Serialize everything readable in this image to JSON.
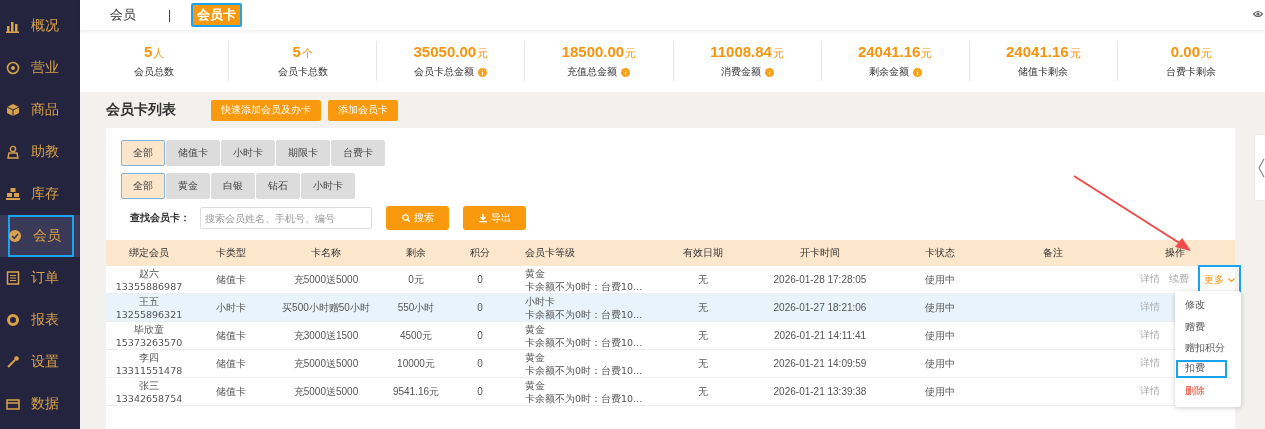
{
  "sidebar": {
    "items": [
      {
        "label": "概况",
        "selected": false,
        "highlighted": false
      },
      {
        "label": "营业",
        "selected": false,
        "highlighted": false
      },
      {
        "label": "商品",
        "selected": false,
        "highlighted": false
      },
      {
        "label": "助教",
        "selected": false,
        "highlighted": false
      },
      {
        "label": "库存",
        "selected": false,
        "highlighted": false
      },
      {
        "label": "会员",
        "selected": true,
        "highlighted": true
      },
      {
        "label": "订单",
        "selected": false,
        "highlighted": false
      },
      {
        "label": "报表",
        "selected": false,
        "highlighted": false
      },
      {
        "label": "设置",
        "selected": false,
        "highlighted": false
      },
      {
        "label": "数据",
        "selected": false,
        "highlighted": false
      }
    ]
  },
  "tabs": [
    {
      "label": "会员",
      "selected": false,
      "highlighted": false
    },
    {
      "label": "会员卡",
      "selected": true,
      "highlighted": true
    }
  ],
  "tab_separator": "|",
  "stats": [
    {
      "value": "5",
      "unit": "人",
      "label": "会员总数",
      "info": false
    },
    {
      "value": "5",
      "unit": "个",
      "label": "会员卡总数",
      "info": false
    },
    {
      "value": "35050.00",
      "unit": "元",
      "label": "会员卡总金额",
      "info": true
    },
    {
      "value": "18500.00",
      "unit": "元",
      "label": "充值总金额",
      "info": true
    },
    {
      "value": "11008.84",
      "unit": "元",
      "label": "消费金额",
      "info": true
    },
    {
      "value": "24041.16",
      "unit": "元",
      "label": "剩余金额",
      "info": true
    },
    {
      "value": "24041.16",
      "unit": "元",
      "label": "储值卡剩余",
      "info": false
    },
    {
      "value": "0.00",
      "unit": "元",
      "label": "台费卡剩余",
      "info": false
    }
  ],
  "list_title": "会员卡列表",
  "header_buttons": [
    "快速添加会员及办卡",
    "添加会员卡"
  ],
  "card_type_filter": [
    {
      "label": "全部",
      "selected": true
    },
    {
      "label": "储值卡",
      "selected": false
    },
    {
      "label": "小时卡",
      "selected": false
    },
    {
      "label": "期限卡",
      "selected": false
    },
    {
      "label": "台费卡",
      "selected": false
    }
  ],
  "level_filter": [
    {
      "label": "全部",
      "selected": true
    },
    {
      "label": "黄金",
      "selected": false
    },
    {
      "label": "白银",
      "selected": false
    },
    {
      "label": "钻石",
      "selected": false
    },
    {
      "label": "小时卡",
      "selected": false
    }
  ],
  "search": {
    "label": "查找会员卡：",
    "placeholder": "搜索会员姓名、手机号、编号",
    "search_button": "搜索",
    "export_button": "导出"
  },
  "table": {
    "columns": [
      "绑定会员",
      "卡类型",
      "卡名称",
      "剩余",
      "积分",
      "会员卡等级",
      "有效日期",
      "开卡时间",
      "卡状态",
      "备注",
      "操作"
    ],
    "rows": [
      {
        "member": "赵六",
        "phone": "13355886987",
        "card_type": "储值卡",
        "card_name": "充5000送5000",
        "balance": "0元",
        "points": "0",
        "level": "黄金",
        "level_note": "卡余额不为0时：台费10...",
        "expiry": "无",
        "opened": "2026-01-28 17:28:05",
        "status": "使用中",
        "actions": [
          "详情",
          "续费"
        ],
        "more": "更多",
        "more_highlighted": true,
        "hovered": false
      },
      {
        "member": "王五",
        "phone": "13255896321",
        "card_type": "小时卡",
        "card_name": "买500小时赠50小时",
        "balance": "550小时",
        "points": "0",
        "level": "小时卡",
        "level_note": "卡余额不为0时：台费10...",
        "expiry": "无",
        "opened": "2026-01-27 18:21:06",
        "status": "使用中",
        "actions": [
          "详情"
        ],
        "hovered": true
      },
      {
        "member": "毕欣童",
        "phone": "15373263570",
        "card_type": "储值卡",
        "card_name": "充3000送1500",
        "balance": "4500元",
        "points": "0",
        "level": "黄金",
        "level_note": "卡余额不为0时：台费10...",
        "expiry": "无",
        "opened": "2026-01-21 14:11:41",
        "status": "使用中",
        "actions": [
          "详情"
        ],
        "hovered": false
      },
      {
        "member": "李四",
        "phone": "13311551478",
        "card_type": "储值卡",
        "card_name": "充5000送5000",
        "balance": "10000元",
        "points": "0",
        "level": "黄金",
        "level_note": "卡余额不为0时：台费10...",
        "expiry": "无",
        "opened": "2026-01-21 14:09:59",
        "status": "使用中",
        "actions": [
          "详情"
        ],
        "hovered": false
      },
      {
        "member": "张三",
        "phone": "13342658754",
        "card_type": "储值卡",
        "card_name": "充5000送5000",
        "balance": "9541.16元",
        "points": "0",
        "level": "黄金",
        "level_note": "卡余额不为0时：台费10...",
        "expiry": "无",
        "opened": "2026-01-21 13:39:38",
        "status": "使用中",
        "actions": [
          "详情"
        ],
        "hovered": false
      }
    ]
  },
  "more_menu": [
    {
      "label": "修改",
      "kind": "normal",
      "highlighted": false
    },
    {
      "label": "赠费",
      "kind": "normal",
      "highlighted": false
    },
    {
      "label": "赠扣积分",
      "kind": "normal",
      "highlighted": false
    },
    {
      "label": "扣费",
      "kind": "normal",
      "highlighted": true
    },
    {
      "label": "删除",
      "kind": "danger",
      "highlighted": false
    }
  ]
}
